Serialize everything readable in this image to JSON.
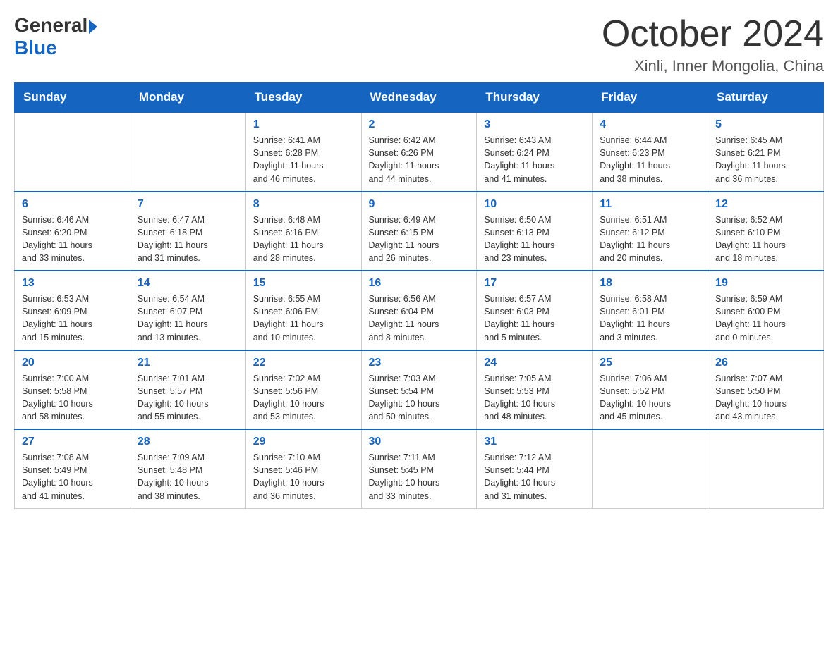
{
  "logo": {
    "general": "General",
    "blue": "Blue"
  },
  "title": {
    "month": "October 2024",
    "location": "Xinli, Inner Mongolia, China"
  },
  "weekdays": [
    "Sunday",
    "Monday",
    "Tuesday",
    "Wednesday",
    "Thursday",
    "Friday",
    "Saturday"
  ],
  "weeks": [
    [
      {
        "day": "",
        "info": ""
      },
      {
        "day": "",
        "info": ""
      },
      {
        "day": "1",
        "info": "Sunrise: 6:41 AM\nSunset: 6:28 PM\nDaylight: 11 hours\nand 46 minutes."
      },
      {
        "day": "2",
        "info": "Sunrise: 6:42 AM\nSunset: 6:26 PM\nDaylight: 11 hours\nand 44 minutes."
      },
      {
        "day": "3",
        "info": "Sunrise: 6:43 AM\nSunset: 6:24 PM\nDaylight: 11 hours\nand 41 minutes."
      },
      {
        "day": "4",
        "info": "Sunrise: 6:44 AM\nSunset: 6:23 PM\nDaylight: 11 hours\nand 38 minutes."
      },
      {
        "day": "5",
        "info": "Sunrise: 6:45 AM\nSunset: 6:21 PM\nDaylight: 11 hours\nand 36 minutes."
      }
    ],
    [
      {
        "day": "6",
        "info": "Sunrise: 6:46 AM\nSunset: 6:20 PM\nDaylight: 11 hours\nand 33 minutes."
      },
      {
        "day": "7",
        "info": "Sunrise: 6:47 AM\nSunset: 6:18 PM\nDaylight: 11 hours\nand 31 minutes."
      },
      {
        "day": "8",
        "info": "Sunrise: 6:48 AM\nSunset: 6:16 PM\nDaylight: 11 hours\nand 28 minutes."
      },
      {
        "day": "9",
        "info": "Sunrise: 6:49 AM\nSunset: 6:15 PM\nDaylight: 11 hours\nand 26 minutes."
      },
      {
        "day": "10",
        "info": "Sunrise: 6:50 AM\nSunset: 6:13 PM\nDaylight: 11 hours\nand 23 minutes."
      },
      {
        "day": "11",
        "info": "Sunrise: 6:51 AM\nSunset: 6:12 PM\nDaylight: 11 hours\nand 20 minutes."
      },
      {
        "day": "12",
        "info": "Sunrise: 6:52 AM\nSunset: 6:10 PM\nDaylight: 11 hours\nand 18 minutes."
      }
    ],
    [
      {
        "day": "13",
        "info": "Sunrise: 6:53 AM\nSunset: 6:09 PM\nDaylight: 11 hours\nand 15 minutes."
      },
      {
        "day": "14",
        "info": "Sunrise: 6:54 AM\nSunset: 6:07 PM\nDaylight: 11 hours\nand 13 minutes."
      },
      {
        "day": "15",
        "info": "Sunrise: 6:55 AM\nSunset: 6:06 PM\nDaylight: 11 hours\nand 10 minutes."
      },
      {
        "day": "16",
        "info": "Sunrise: 6:56 AM\nSunset: 6:04 PM\nDaylight: 11 hours\nand 8 minutes."
      },
      {
        "day": "17",
        "info": "Sunrise: 6:57 AM\nSunset: 6:03 PM\nDaylight: 11 hours\nand 5 minutes."
      },
      {
        "day": "18",
        "info": "Sunrise: 6:58 AM\nSunset: 6:01 PM\nDaylight: 11 hours\nand 3 minutes."
      },
      {
        "day": "19",
        "info": "Sunrise: 6:59 AM\nSunset: 6:00 PM\nDaylight: 11 hours\nand 0 minutes."
      }
    ],
    [
      {
        "day": "20",
        "info": "Sunrise: 7:00 AM\nSunset: 5:58 PM\nDaylight: 10 hours\nand 58 minutes."
      },
      {
        "day": "21",
        "info": "Sunrise: 7:01 AM\nSunset: 5:57 PM\nDaylight: 10 hours\nand 55 minutes."
      },
      {
        "day": "22",
        "info": "Sunrise: 7:02 AM\nSunset: 5:56 PM\nDaylight: 10 hours\nand 53 minutes."
      },
      {
        "day": "23",
        "info": "Sunrise: 7:03 AM\nSunset: 5:54 PM\nDaylight: 10 hours\nand 50 minutes."
      },
      {
        "day": "24",
        "info": "Sunrise: 7:05 AM\nSunset: 5:53 PM\nDaylight: 10 hours\nand 48 minutes."
      },
      {
        "day": "25",
        "info": "Sunrise: 7:06 AM\nSunset: 5:52 PM\nDaylight: 10 hours\nand 45 minutes."
      },
      {
        "day": "26",
        "info": "Sunrise: 7:07 AM\nSunset: 5:50 PM\nDaylight: 10 hours\nand 43 minutes."
      }
    ],
    [
      {
        "day": "27",
        "info": "Sunrise: 7:08 AM\nSunset: 5:49 PM\nDaylight: 10 hours\nand 41 minutes."
      },
      {
        "day": "28",
        "info": "Sunrise: 7:09 AM\nSunset: 5:48 PM\nDaylight: 10 hours\nand 38 minutes."
      },
      {
        "day": "29",
        "info": "Sunrise: 7:10 AM\nSunset: 5:46 PM\nDaylight: 10 hours\nand 36 minutes."
      },
      {
        "day": "30",
        "info": "Sunrise: 7:11 AM\nSunset: 5:45 PM\nDaylight: 10 hours\nand 33 minutes."
      },
      {
        "day": "31",
        "info": "Sunrise: 7:12 AM\nSunset: 5:44 PM\nDaylight: 10 hours\nand 31 minutes."
      },
      {
        "day": "",
        "info": ""
      },
      {
        "day": "",
        "info": ""
      }
    ]
  ]
}
